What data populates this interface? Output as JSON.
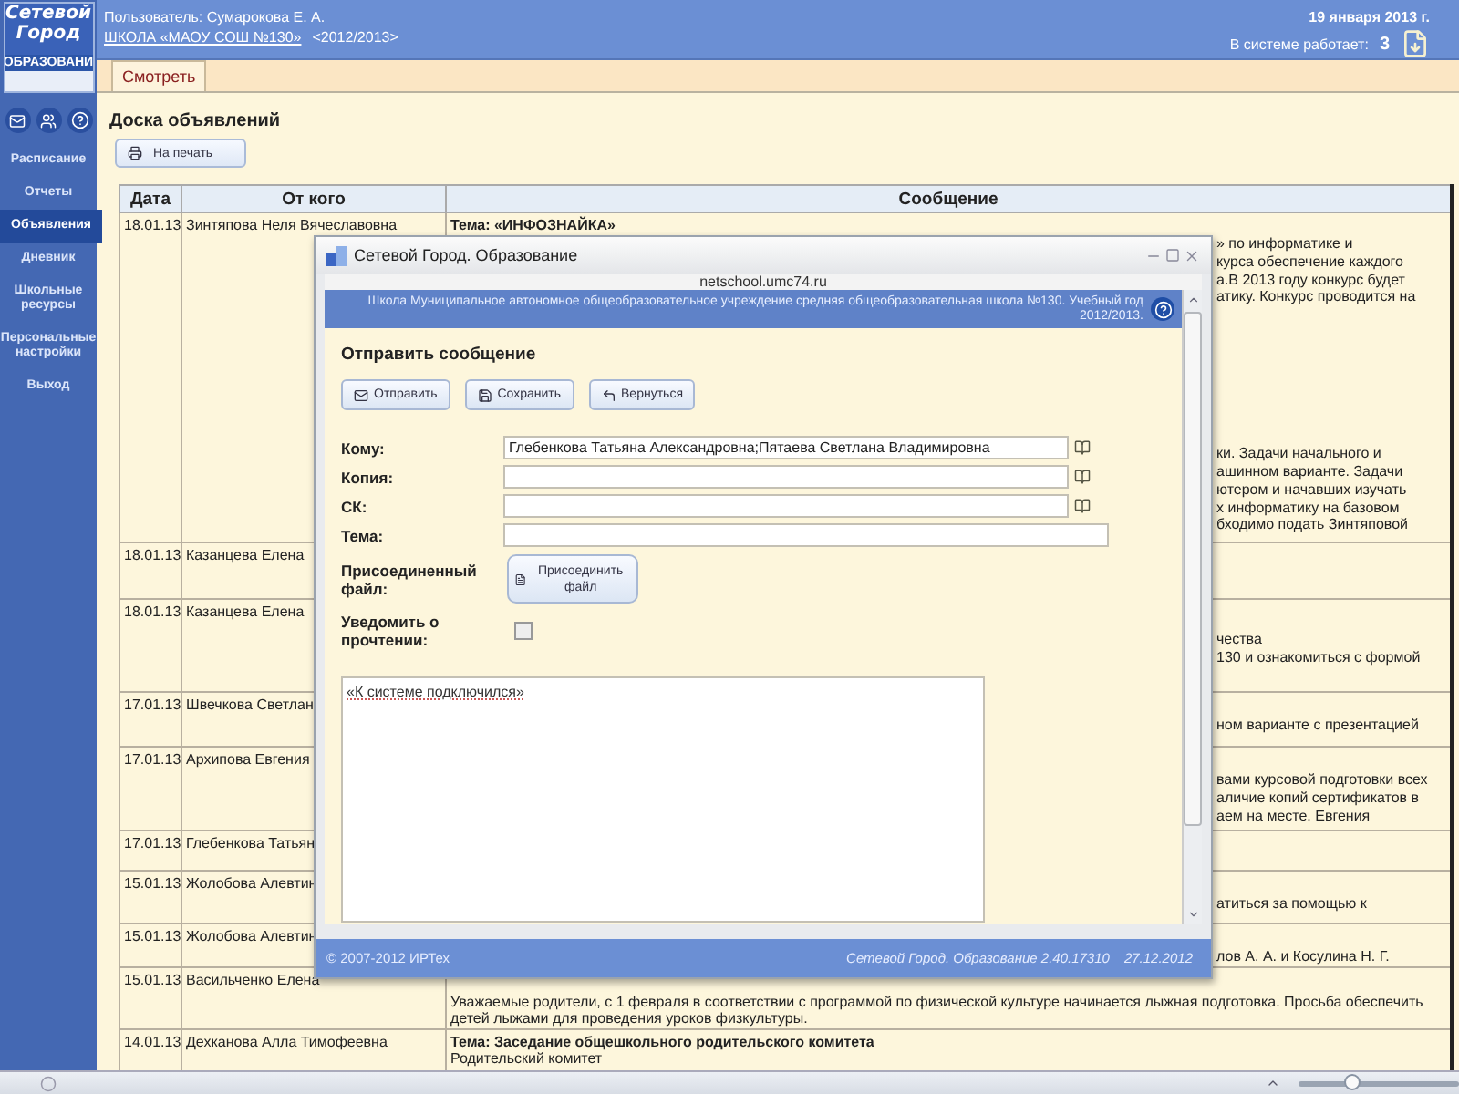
{
  "sidebar": {
    "logo": {
      "line_1": "Сетевой",
      "line_2": "Город",
      "line_3": "ОБРАЗОВАНИ"
    },
    "items": [
      {
        "label": "Расписание",
        "selected": false
      },
      {
        "label": "Отчеты",
        "selected": false
      },
      {
        "label": "Объявления",
        "selected": true
      },
      {
        "label": "Дневник",
        "selected": false
      },
      {
        "label": "Школьные ресурсы",
        "selected": false
      },
      {
        "label": "Персональные настройки",
        "selected": false
      },
      {
        "label": "Выход",
        "selected": false
      }
    ]
  },
  "header": {
    "user": "Пользователь: Сумарокова Е. А.",
    "school_link": "ШКОЛА «МАОУ СОШ №130»",
    "year": "<2012/2013>",
    "date": "19 января 2013 г.",
    "online": "В системе работает:",
    "online_count": "3"
  },
  "tabs": [
    {
      "label": "Смотреть",
      "selected": true
    }
  ],
  "page_title": "Доска объявлений",
  "print_button": "На печать",
  "table": {
    "columns": [
      "Дата",
      "От кого",
      "Сообщение"
    ],
    "rows": [
      {
        "date": "18.01.13",
        "from": "Зинтяпова Неля Вячеславовна",
        "message": {
          "title": "Тема: «ИНФОЗНАЙКА»",
          "fragments": [
            [
              "» по информатике и",
              "курса обеспечение каждого",
              "а.В 2013 году конкурс будет",
              "атику. Конкурс проводится на"
            ],
            [
              "ки. Задачи начального и",
              "ашинном варианте. Задачи",
              "ютером и начавших изучать",
              "х информатику на базовом",
              "бходимо подать Зинтяповой"
            ]
          ]
        }
      },
      {
        "date": "18.01.13",
        "from": "Казанцева Елена"
      },
      {
        "date": "18.01.13",
        "from": "Казанцева Елена",
        "message": {
          "fragments": [
            [
              "чества",
              "130 и ознакомиться с формой"
            ]
          ]
        }
      },
      {
        "date": "17.01.13",
        "from": "Швечкова Светлан",
        "message": {
          "fragments": [
            [
              "ном варианте с презентацией"
            ]
          ]
        }
      },
      {
        "date": "17.01.13",
        "from": "Архипова Евгения",
        "message": {
          "fragments": [
            [
              "вами курсовой подготовки всех",
              "аличие копий сертификатов в",
              "аем на месте. Евгения"
            ]
          ]
        }
      },
      {
        "date": "17.01.13",
        "from": "Глебенкова Татьян"
      },
      {
        "date": "15.01.13",
        "from": "Жолобова Алевтин",
        "message": {
          "fragments": [
            [
              "атиться за помощью к"
            ]
          ]
        }
      },
      {
        "date": "15.01.13",
        "from": "Жолобова Алевтин",
        "message": {
          "fragments": [
            [
              "лов А. А. и Косулина Н. Г."
            ]
          ]
        }
      },
      {
        "date": "15.01.13",
        "from": "Васильченко Елена",
        "message": {
          "text": "Уважаемые родители, с 1 февраля в соответствии с программой по физической культуре начинается лыжная подготовка. Просьба обеспечить детей лыжами для проведения уроков физкультуры."
        }
      },
      {
        "date": "14.01.13",
        "from": "Дехканова Алла Тимофеевна",
        "message": {
          "title": "Тема: Заседание общешкольного родительского комитета",
          "text": "Родительский комитет"
        }
      }
    ]
  },
  "dialog": {
    "title": "Сетевой Город. Образование",
    "url": "netschool.umc74.ru",
    "school": "Школа Муниципальное автономное общеобразовательное учреждение средняя общеобразовательная школа №130. Учебный год 2012/2013.",
    "heading": "Отправить сообщение",
    "buttons": [
      {
        "label": "Отправить",
        "kind": "send"
      },
      {
        "label": "Сохранить",
        "kind": "save"
      },
      {
        "label": "Вернуться",
        "kind": "back"
      }
    ],
    "fields": [
      {
        "label": "Кому:",
        "value": "Глебенкова Татьяна Александровна;Пятаева Светлана Владимировна",
        "kind": "address"
      },
      {
        "label": "Копия:",
        "kind": "address"
      },
      {
        "label": "СК:",
        "kind": "address"
      },
      {
        "label": "Тема:",
        "kind": "text"
      }
    ],
    "attach": {
      "label": "Присоединенный файл:",
      "button": "Присоединить файл"
    },
    "notify": {
      "label": "Уведомить о прочтении:",
      "checked": false
    },
    "body": "«К системе подключился»",
    "footer": {
      "copyright": "© 2007-2012 ИРТех",
      "version": "Сетевой Город. Образование 2.40.17310",
      "date": "27.12.2012"
    }
  },
  "status_bar": {
    "zoom_slider": {
      "level": 0.34
    }
  }
}
